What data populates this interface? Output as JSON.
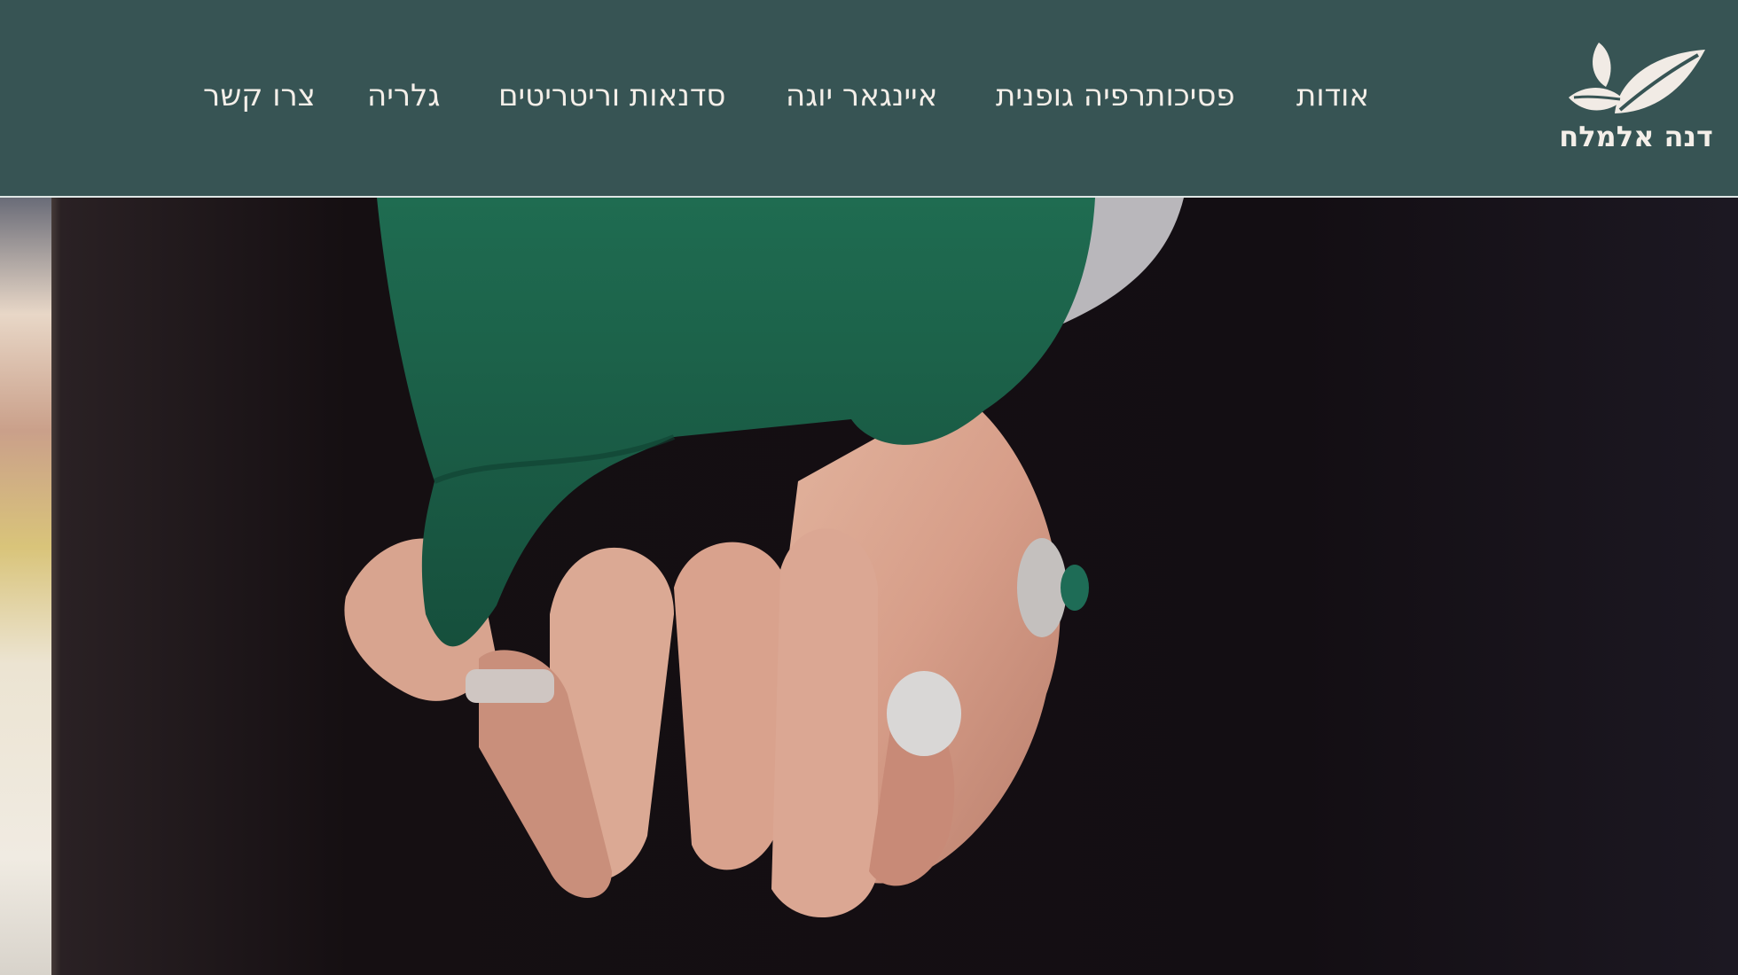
{
  "logo": {
    "name": "דנה אלמלח",
    "icon": "leaves-icon"
  },
  "nav": {
    "items": [
      {
        "label": "אודות"
      },
      {
        "label": "פסיכותרפיה גופנית"
      },
      {
        "label": "איינגאר יוגה"
      },
      {
        "label": "סדנאות וריטריטים"
      },
      {
        "label": "גלריה"
      },
      {
        "label": "צרו קשר"
      }
    ]
  },
  "colors": {
    "header_bg": "#375454",
    "nav_text": "#f4efe9",
    "sleeve_green": "#1d6b4f"
  },
  "hero": {
    "image": "holding-hands-photo"
  }
}
